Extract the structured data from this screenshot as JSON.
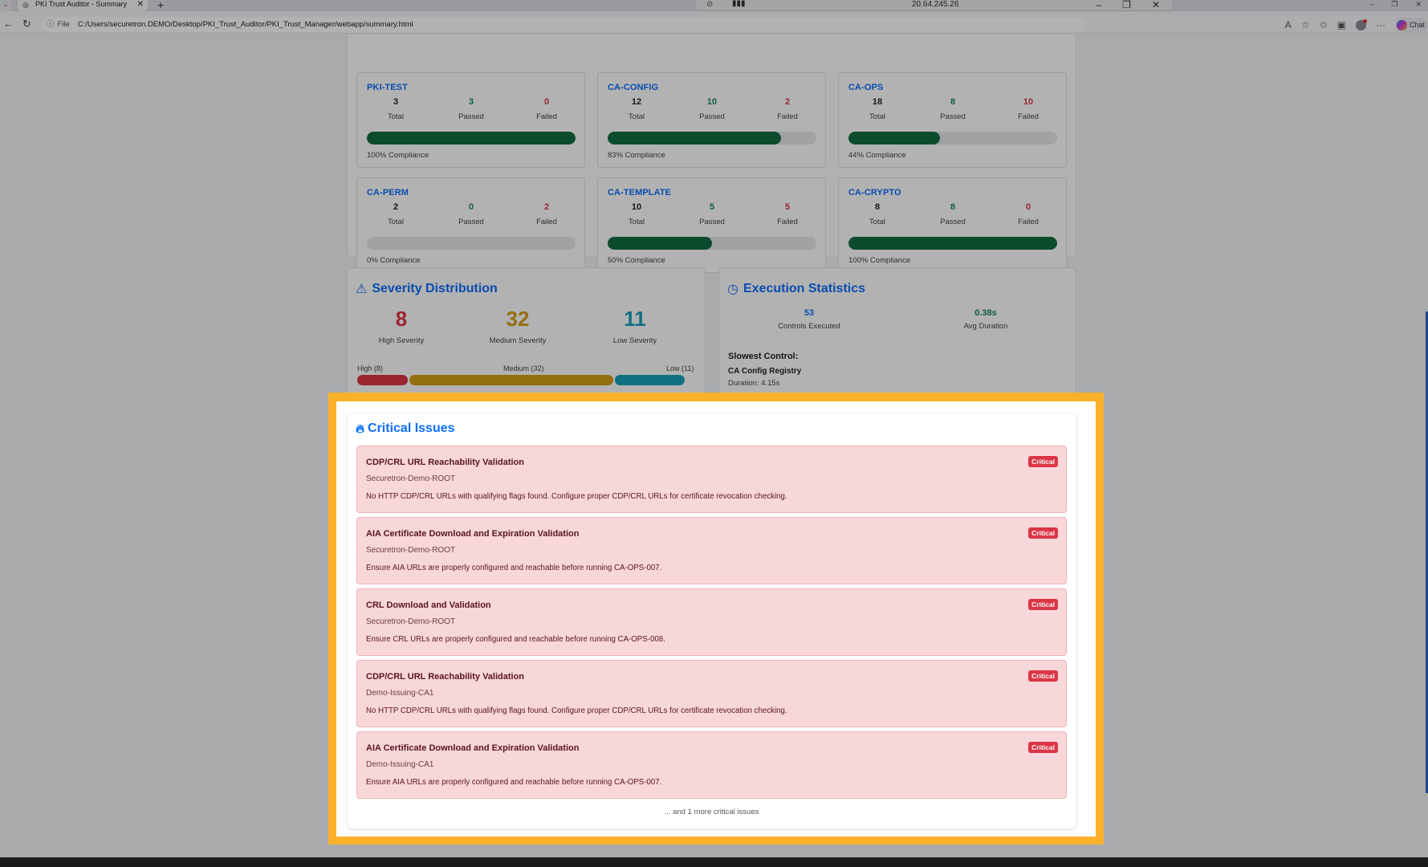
{
  "browser": {
    "tab_title": "PKI Trust Auditor - Summary",
    "tab_close": "✕",
    "new_tab": "+",
    "rdp_ip": "20.64.245.26",
    "url_scheme": "File",
    "url": "C:/Users/securetron.DEMO/Desktop/PKI_Trust_Auditor/PKI_Trust_Manager/webapp/summary.html",
    "copilot_label": "Chat"
  },
  "categories": [
    {
      "name": "PKI-TEST",
      "total": "3",
      "passed": "3",
      "failed": "0",
      "compliance_pct": 100,
      "compliance_text": "100% Compliance"
    },
    {
      "name": "CA-CONFIG",
      "total": "12",
      "passed": "10",
      "failed": "2",
      "compliance_pct": 83,
      "compliance_text": "83% Compliance"
    },
    {
      "name": "CA-OPS",
      "total": "18",
      "passed": "8",
      "failed": "10",
      "compliance_pct": 44,
      "compliance_text": "44% Compliance"
    },
    {
      "name": "CA-PERM",
      "total": "2",
      "passed": "0",
      "failed": "2",
      "compliance_pct": 0,
      "compliance_text": "0% Compliance"
    },
    {
      "name": "CA-TEMPLATE",
      "total": "10",
      "passed": "5",
      "failed": "5",
      "compliance_pct": 50,
      "compliance_text": "50% Compliance"
    },
    {
      "name": "CA-CRYPTO",
      "total": "8",
      "passed": "8",
      "failed": "0",
      "compliance_pct": 100,
      "compliance_text": "100% Compliance"
    }
  ],
  "labels": {
    "total": "Total",
    "passed": "Passed",
    "failed": "Failed"
  },
  "severity": {
    "title": "Severity Distribution",
    "high": "8",
    "medium": "32",
    "low": "11",
    "high_label": "High Severity",
    "medium_label": "Medium Severity",
    "low_label": "Low Severity",
    "bar_high": "High (8)",
    "bar_medium": "Medium (32)",
    "bar_low": "Low (11)",
    "colors": {
      "high": "#dc3545",
      "medium": "#d4a017",
      "low": "#17a2b8"
    }
  },
  "execution": {
    "title": "Execution Statistics",
    "controls_executed": "53",
    "controls_label": "Controls Executed",
    "avg_duration": "0.38s",
    "avg_label": "Avg Duration",
    "slowest_heading": "Slowest Control:",
    "slowest_name": "CA Config Registry",
    "slowest_duration": "Duration: 4.15s"
  },
  "critical": {
    "title": "Critical Issues",
    "badge": "Critical",
    "issues": [
      {
        "title": "CDP/CRL URL Reachability Validation",
        "ca": "Securetron-Demo-ROOT",
        "desc": "No HTTP CDP/CRL URLs with qualifying flags found. Configure proper CDP/CRL URLs for certificate revocation checking."
      },
      {
        "title": "AIA Certificate Download and Expiration Validation",
        "ca": "Securetron-Demo-ROOT",
        "desc": "Ensure AIA URLs are properly configured and reachable before running CA-OPS-007."
      },
      {
        "title": "CRL Download and Validation",
        "ca": "Securetron-Demo-ROOT",
        "desc": "Ensure CRL URLs are properly configured and reachable before running CA-OPS-008."
      },
      {
        "title": "CDP/CRL URL Reachability Validation",
        "ca": "Demo-Issuing-CA1",
        "desc": "No HTTP CDP/CRL URLs with qualifying flags found. Configure proper CDP/CRL URLs for certificate revocation checking."
      },
      {
        "title": "AIA Certificate Download and Expiration Validation",
        "ca": "Demo-Issuing-CA1",
        "desc": "Ensure AIA URLs are properly configured and reachable before running CA-OPS-007."
      }
    ],
    "more": "... and 1 more critical issues"
  },
  "colors": {
    "accent": "#0d6efd",
    "highlight": "#fbb22a",
    "pass_bar": "#146c43"
  }
}
